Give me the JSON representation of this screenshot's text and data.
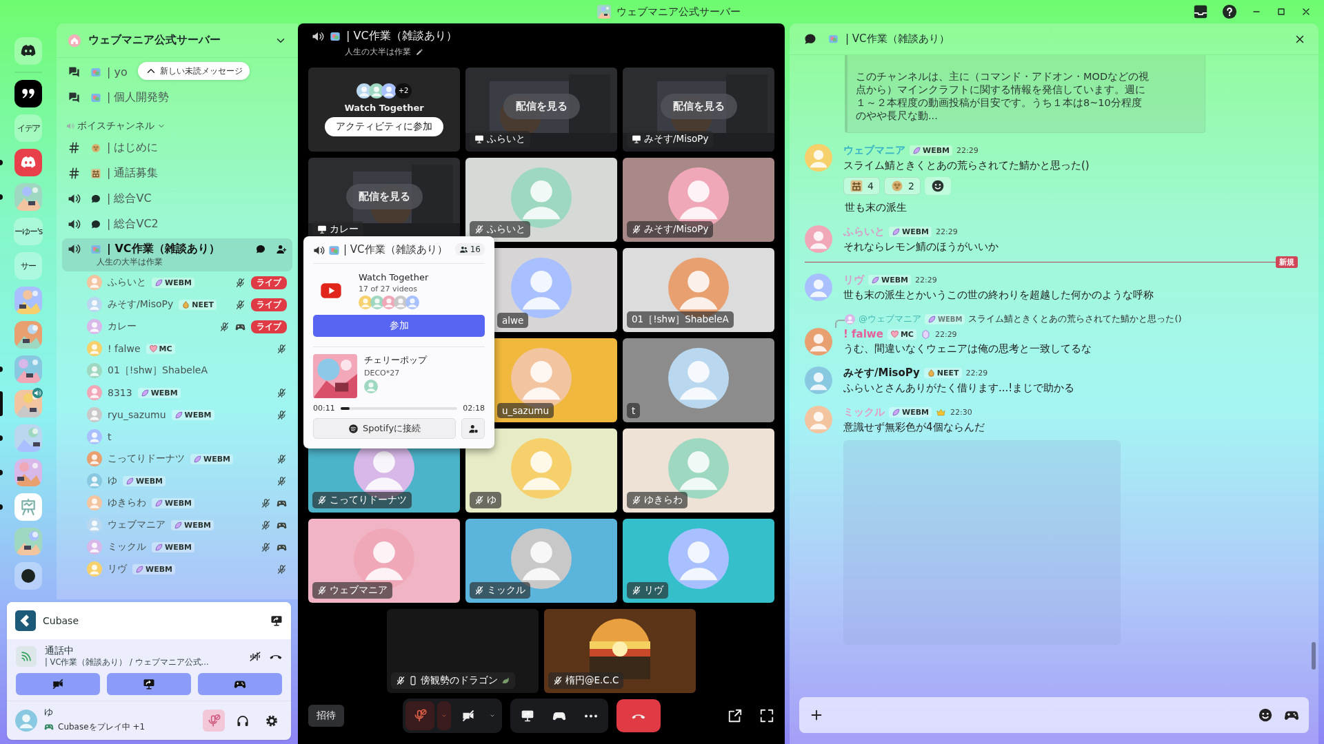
{
  "title_bar": {
    "title": "ウェブマニア公式サーバー"
  },
  "servers": [
    {
      "kind": "home",
      "unread": false,
      "selected": false,
      "in_voice": false
    },
    {
      "kind": "quote",
      "unread": false,
      "selected": false,
      "in_voice": false
    },
    {
      "kind": "text",
      "label": "イデア",
      "unread": false,
      "selected": false,
      "in_voice": false
    },
    {
      "kind": "discord",
      "unread": true,
      "selected": false,
      "in_voice": false
    },
    {
      "kind": "picture",
      "unread": true,
      "selected": false,
      "in_voice": false
    },
    {
      "kind": "text",
      "label": "ーゆー's",
      "unread": false,
      "selected": false,
      "in_voice": false
    },
    {
      "kind": "text",
      "label": "サー",
      "unread": false,
      "selected": false,
      "in_voice": false
    },
    {
      "kind": "picture",
      "unread": false,
      "selected": false,
      "in_voice": false
    },
    {
      "kind": "picture",
      "unread": false,
      "selected": false,
      "in_voice": false
    },
    {
      "kind": "picture",
      "unread": true,
      "selected": false,
      "in_voice": false
    },
    {
      "kind": "picture",
      "unread": false,
      "selected": true,
      "in_voice": true
    },
    {
      "kind": "picture",
      "unread": true,
      "selected": false,
      "in_voice": false
    },
    {
      "kind": "picture",
      "unread": true,
      "selected": false,
      "in_voice": false
    },
    {
      "kind": "easel",
      "unread": true,
      "selected": false,
      "in_voice": false
    },
    {
      "kind": "picture",
      "unread": false,
      "selected": false,
      "in_voice": false
    },
    {
      "kind": "add",
      "unread": false,
      "selected": false,
      "in_voice": false
    }
  ],
  "sidebar": {
    "server_name": "ウェブマニア公式サーバー",
    "unread_pill": "新しい未読メッセージ",
    "channels": [
      {
        "kind": "forum",
        "name": "| yo",
        "selected": false
      },
      {
        "kind": "forum",
        "name": "| 個人開発勢",
        "selected": false
      },
      {
        "kind": "category",
        "name": "ボイスチャンネル",
        "expanded": true
      },
      {
        "kind": "text",
        "name": "| はじめに",
        "selected": false
      },
      {
        "kind": "text",
        "name": "| 通話募集",
        "selected": false
      },
      {
        "kind": "voice",
        "name": "| 総合VC",
        "selected": false
      },
      {
        "kind": "voice",
        "name": "| 総合VC2",
        "selected": false
      },
      {
        "kind": "voice",
        "name": "| VC作業（雑談あり）",
        "topic": "人生の大半は作業",
        "selected": true
      }
    ],
    "voice_users": [
      {
        "name": "ふらいと",
        "badge": {
          "kind": "webm",
          "label": "WEBM"
        },
        "muted": true,
        "gaming": false,
        "live": "ライブ"
      },
      {
        "name": "みそす/MisoPy",
        "badge": {
          "kind": "neet",
          "label": "NEET"
        },
        "muted": true,
        "gaming": false,
        "live": "ライブ"
      },
      {
        "name": "カレー",
        "muted": true,
        "gaming": true,
        "live": "ライブ"
      },
      {
        "name": "! falwe",
        "badge": {
          "kind": "mc",
          "label": "MC"
        },
        "muted": true,
        "gaming": false
      },
      {
        "name": "01［!shw］ShabeleA",
        "muted": false,
        "gaming": false
      },
      {
        "name": "8313",
        "badge": {
          "kind": "webm",
          "label": "WEBM"
        },
        "muted": true,
        "gaming": false
      },
      {
        "name": "ryu_sazumu",
        "badge": {
          "kind": "webm",
          "label": "WEBM"
        },
        "muted": true,
        "gaming": false
      },
      {
        "name": "t",
        "muted": false,
        "gaming": false
      },
      {
        "name": "こってりドーナツ",
        "badge": {
          "kind": "webm",
          "label": "WEBM"
        },
        "muted": true,
        "gaming": false
      },
      {
        "name": "ゆ",
        "badge": {
          "kind": "webm",
          "label": "WEBM"
        },
        "muted": true,
        "gaming": false
      },
      {
        "name": "ゆきらわ",
        "badge": {
          "kind": "webm",
          "label": "WEBM"
        },
        "muted": true,
        "gaming": true
      },
      {
        "name": "ウェブマニア",
        "badge": {
          "kind": "webm",
          "label": "WEBM"
        },
        "muted": true,
        "gaming": true
      },
      {
        "name": "ミックル",
        "badge": {
          "kind": "webm",
          "label": "WEBM"
        },
        "muted": true,
        "gaming": true
      },
      {
        "name": "リヴ",
        "badge": {
          "kind": "webm",
          "label": "WEBM"
        },
        "muted": true,
        "gaming": false
      }
    ]
  },
  "user_panel": {
    "activity": "Cubase",
    "status": "通話中",
    "location": "| VC作業（雑談あり） / ウェブマニア公式...",
    "user_name": "ゆ",
    "user_activity": "Cubaseをプレイ中 +1",
    "mic_muted": true
  },
  "voice": {
    "title": "| VC作業（雑談あり）",
    "topic": "人生の大半は作業",
    "tiles": [
      {
        "kind": "activity",
        "title": "Watch Together",
        "extra": "+2",
        "button": "アクティビティに参加"
      },
      {
        "kind": "stream",
        "button": "配信を見る",
        "name": "ふらいと"
      },
      {
        "kind": "stream",
        "button": "配信を見る",
        "name": "みそす/MisoPy"
      },
      {
        "kind": "stream",
        "button": "配信を見る",
        "name": "カレー"
      },
      {
        "kind": "user",
        "name": "ふらいと",
        "muted": true,
        "color": "#d5dad6"
      },
      {
        "kind": "user",
        "name": "みそす/MisoPy",
        "muted": true,
        "color": "#a98888"
      },
      {
        "kind": "covered"
      },
      {
        "kind": "user",
        "name": "alwe",
        "muted": false,
        "color": "#d8d5d6"
      },
      {
        "kind": "user",
        "name": "01［!shw］ShabeleA",
        "muted": false,
        "color": "#dcdcdc"
      },
      {
        "kind": "covered"
      },
      {
        "kind": "user",
        "name": "u_sazumu",
        "muted": false,
        "color": "#f0b83c"
      },
      {
        "kind": "user",
        "name": "t",
        "muted": false,
        "color": "#8c8c8c"
      },
      {
        "kind": "user",
        "name": "こってりドーナツ",
        "muted": true,
        "color": "#4cb3c8"
      },
      {
        "kind": "user",
        "name": "ゆ",
        "muted": true,
        "color": "#e8ecc6"
      },
      {
        "kind": "user",
        "name": "ゆきらわ",
        "muted": true,
        "color": "#eee2d6"
      },
      {
        "kind": "user",
        "name": "ウェブマニア",
        "muted": true,
        "color": "#f0b4c4"
      },
      {
        "kind": "user",
        "name": "ミックル",
        "muted": true,
        "color": "#5ab4dc"
      },
      {
        "kind": "user",
        "name": "リヴ",
        "muted": true,
        "color": "#34bfcb"
      }
    ],
    "bottom_tiles": [
      {
        "name": "傍観勢のドラゴン",
        "muted": true,
        "mobile": true,
        "color": "#171717"
      },
      {
        "name": "楕円@E.C.C",
        "muted": true,
        "mobile": false,
        "color": "#5c3417"
      }
    ],
    "invite": "招待",
    "mic_muted": true,
    "popup": {
      "title": "| VC作業（雑談あり）",
      "count": "16",
      "activity_title": "Watch Together",
      "activity_detail": "17 of 27 videos",
      "join": "参加",
      "song": "チェリーポップ",
      "artist": "DECO*27",
      "elapsed": "00:11",
      "level": 0.08,
      "duration": "02:18",
      "connect": "Spotifyに接続"
    }
  },
  "chat": {
    "title": "| VC作業（雑談あり）",
    "embed": "このチャンネルは、主に（コマンド・アドオン・MODなどの視点から）マインクラフトに関する情報を発信しています。週に１～２本程度の動画投稿が目安です。うち１本は8~10分程度のやや長尺な動...",
    "messages": [
      {
        "kind": "message",
        "author": "ウェブマニア",
        "color": "#37b4c6",
        "badge": {
          "kind": "webm",
          "label": "WEBM"
        },
        "time": "22:29",
        "text": "スライム鯖ときくとあの荒らされてた鯖かと思った()",
        "reactions": [
          {
            "count": "4"
          },
          {
            "count": "2"
          }
        ]
      },
      {
        "kind": "continuation",
        "text": "世も末の派生"
      },
      {
        "kind": "message",
        "author": "ふらいと",
        "color": "#d99cc8",
        "badge": {
          "kind": "webm",
          "label": "WEBM"
        },
        "time": "22:29",
        "text": "それならレモン鯖のほうがいいか"
      },
      {
        "kind": "divider",
        "label": "新規"
      },
      {
        "kind": "message",
        "author": "リヴ",
        "color": "#d99cc8",
        "badge": {
          "kind": "webm",
          "label": "WEBM"
        },
        "time": "22:29",
        "text": "世も末の派生とかいうこの世の終わりを超越した何かのような呼称"
      },
      {
        "kind": "message",
        "reply": {
          "author": "@ウェブマニア",
          "badge": {
            "kind": "webm",
            "label": "WEBM"
          },
          "text": "スライム鯖ときくとあの荒らされてた鯖かと思った()"
        },
        "author": "! falwe",
        "color": "#e4609a",
        "badge": {
          "kind": "mc",
          "label": "MC"
        },
        "flair": {
          "kind": "gem"
        },
        "time": "22:29",
        "text": "うむ、間違いなくウェニアは俺の思考と一致してるな"
      },
      {
        "kind": "message",
        "author": "みそす/MisoPy",
        "color": "#1e1e1e",
        "badge": {
          "kind": "neet",
          "label": "NEET"
        },
        "time": "22:29",
        "text": "ふらいとさんありがたく借ります...!まじで助かる"
      },
      {
        "kind": "message",
        "author": "ミックル",
        "color": "#e59cc4",
        "badge": {
          "kind": "webm",
          "label": "WEBM"
        },
        "flair": {
          "kind": "crown"
        },
        "time": "22:30",
        "text": "意識せず無彩色が4個ならんだ",
        "image_placeholder": true
      }
    ]
  }
}
